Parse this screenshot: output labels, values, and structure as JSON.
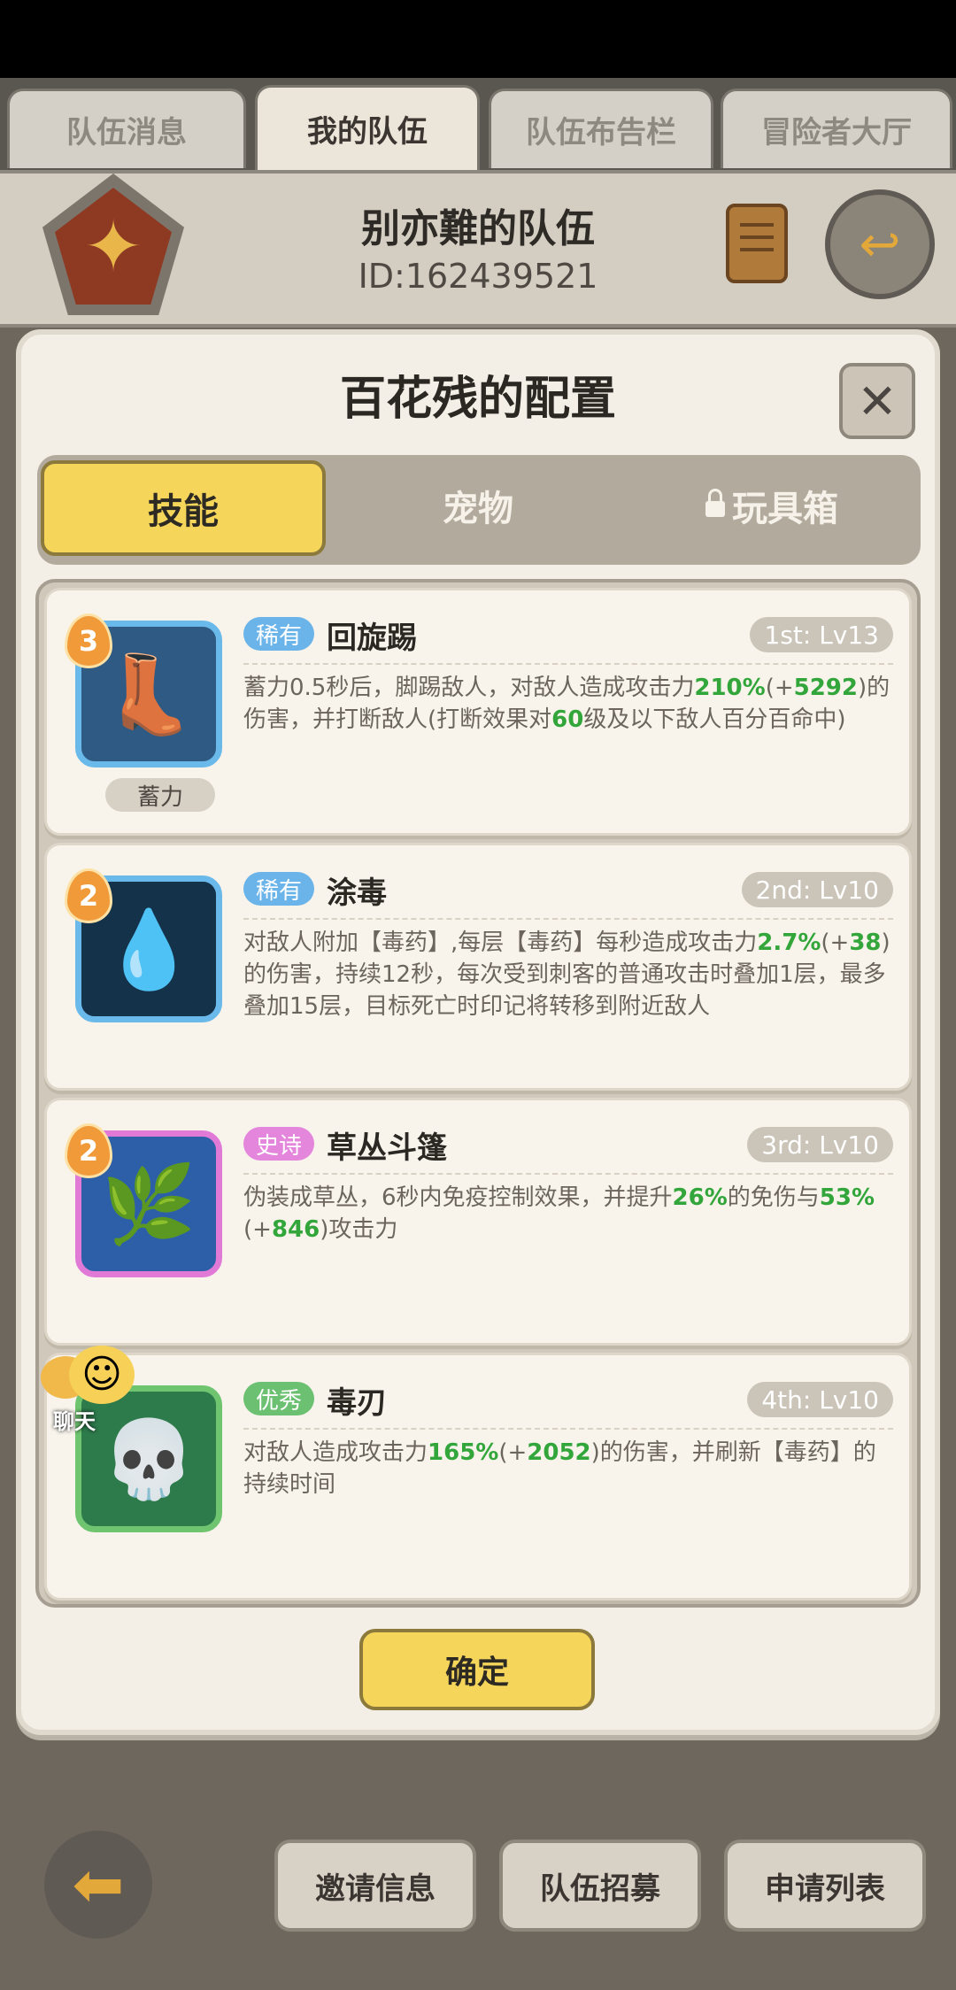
{
  "top_tabs": [
    "队伍消息",
    "我的队伍",
    "队伍布告栏",
    "冒险者大厅"
  ],
  "active_top_tab": 1,
  "team": {
    "name": "别亦難的队伍",
    "id": "ID:162439521"
  },
  "dialog": {
    "title": "百花残的配置",
    "close_symbol": "✕",
    "tabs": {
      "skills": "技能",
      "pets": "宠物",
      "toybox": "玩具箱"
    }
  },
  "skills": [
    {
      "level_badge": "3",
      "rarity": "稀有",
      "name": "回旋踢",
      "slot": "1st: Lv13",
      "extra_label": "蓄力",
      "desc_parts": [
        "蓄力0.5秒后，脚踢敌人，对敌人造成攻击力",
        "210%",
        "(+",
        "5292",
        ")的伤害，并打断敌人(打断效果对",
        "60",
        "级及以下敌人百分百命中)"
      ]
    },
    {
      "level_badge": "2",
      "rarity": "稀有",
      "name": "涂毒",
      "slot": "2nd: Lv10",
      "desc_parts": [
        "对敌人附加【毒药】,每层【毒药】每秒造成攻击力",
        "2.7%",
        "(+",
        "38",
        ")的伤害，持续12秒，每次受到刺客的普通攻击时叠加1层，最多叠加15层，目标死亡时印记将转移到附近敌人"
      ]
    },
    {
      "level_badge": "2",
      "rarity": "史诗",
      "name": "草丛斗篷",
      "slot": "3rd: Lv10",
      "desc_parts": [
        "伪装成草丛，6秒内免疫控制效果，并提升",
        "26%",
        "的免伤与",
        "53%",
        "(+",
        "846",
        ")攻击力"
      ]
    },
    {
      "rarity": "优秀",
      "name": "毒刃",
      "slot": "4th: Lv10",
      "desc_parts": [
        "对敌人造成攻击力",
        "165%",
        "(+",
        "2052",
        ")的伤害，并刷新【毒药】的持续时间"
      ]
    }
  ],
  "confirm_label": "确定",
  "chat_label": "聊天",
  "bottom_buttons": {
    "invite": "邀请信息",
    "recruit": "队伍招募",
    "apply": "申请列表"
  },
  "colors": {
    "highlight": "#32a63a",
    "button_yellow": "#f5d65a",
    "rare": "#6bb4ea",
    "epic": "#e586dd",
    "good": "#6cc071"
  }
}
